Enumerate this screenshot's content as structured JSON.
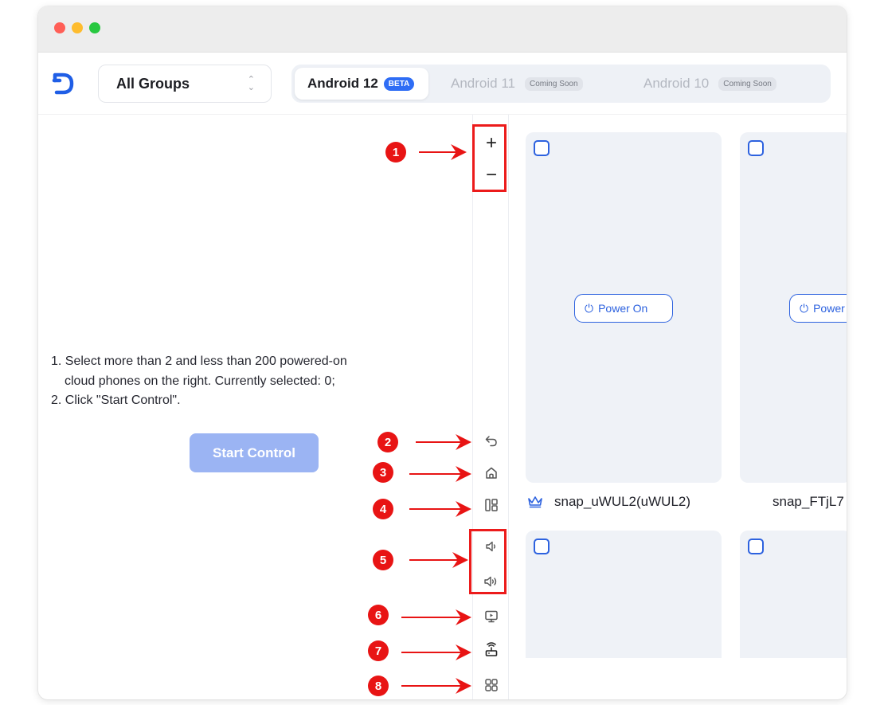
{
  "topbar": {
    "group_select": {
      "label": "All Groups"
    },
    "tabs": [
      {
        "label": "Android 12",
        "badge": "BETA"
      },
      {
        "label": "Android 11",
        "badge": "Coming Soon"
      },
      {
        "label": "Android 10",
        "badge": "Coming Soon"
      }
    ]
  },
  "instructions": {
    "line1": "1. Select more than 2 and less than 200 powered-on",
    "line2": "cloud phones on the right. Currently selected: 0;",
    "line3": "2. Click \"Start Control\"."
  },
  "start_control": {
    "label": "Start Control"
  },
  "toolbar": {
    "zoom_in": "+",
    "zoom_out": "−"
  },
  "annotations": [
    "1",
    "2",
    "3",
    "4",
    "5",
    "6",
    "7",
    "8"
  ],
  "devices": [
    {
      "power_label": "Power On",
      "name": "snap_uWUL2(uWUL2)"
    },
    {
      "power_label": "Power On",
      "name": "snap_FTjL7"
    },
    {
      "power_label": "",
      "name": ""
    },
    {
      "power_label": "",
      "name": ""
    }
  ],
  "colors": {
    "accent": "#2d62df",
    "start_button": "#9bb4f3",
    "annotation_red": "#e81414",
    "card_bg": "#eff2f7"
  }
}
